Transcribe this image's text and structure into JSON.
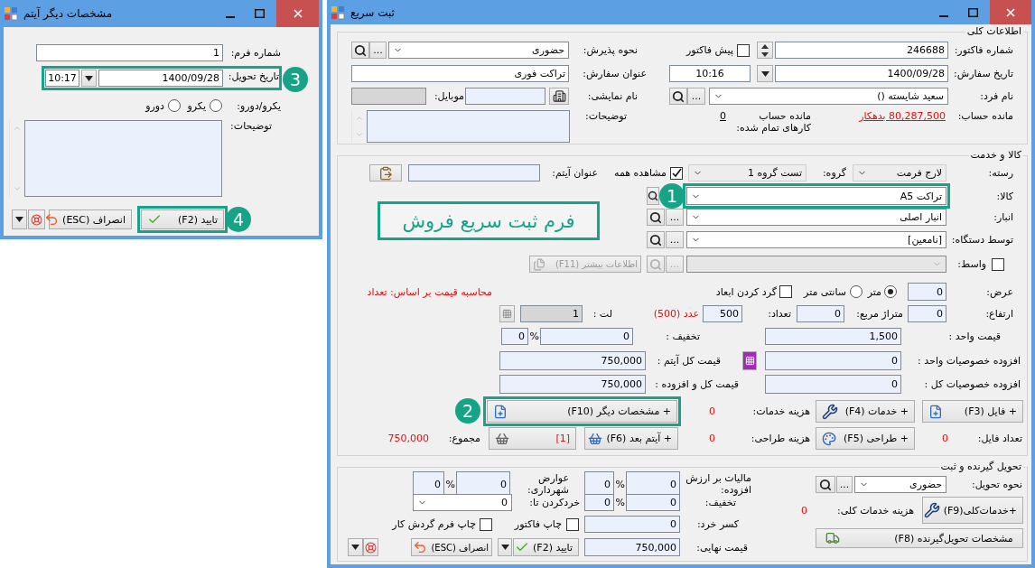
{
  "dialog": {
    "title": "مشخصات دیگر آیتم",
    "form_number": {
      "label": "شماره فرم:",
      "value": "1"
    },
    "delivery_date": {
      "label": "تاریخ تحویل:",
      "date": "1400/09/28",
      "time": "10:17",
      "callout": "3"
    },
    "sides": {
      "label": "یکرو/دورو:",
      "options": [
        {
          "label": "یکرو",
          "selected": false
        },
        {
          "label": "دورو",
          "selected": false
        }
      ]
    },
    "notes": {
      "label": "توضیحات:"
    },
    "ok_button": {
      "label": "تایید (F2)",
      "callout": "4"
    },
    "cancel_button": {
      "label": "انصراف (ESC)"
    }
  },
  "window": {
    "title": "ثبت سریع",
    "general": {
      "legend": "اطلاعات کلی",
      "invoice_number": {
        "label": "شماره فاکتور:",
        "value": "246688"
      },
      "pre_invoice": {
        "label": "پیش فاکتور",
        "checked": false
      },
      "reception": {
        "label": "نحوه پذیرش:",
        "value": "حضوری",
        "browse": "..."
      },
      "order_date": {
        "label": "تاریخ سفارش:",
        "date": "1400/09/28",
        "time": "10:16"
      },
      "order_title": {
        "label": "عنوان سفارش:",
        "value": "تراکت فوری"
      },
      "person": {
        "label": "نام فرد:",
        "value": "سعید شایسته ()",
        "browse": "..."
      },
      "display_name": {
        "label": "نام نمایشی:"
      },
      "mobile": {
        "label": "موبایل:"
      },
      "balance": {
        "label": "مانده حساب:",
        "value": "80,287,500 بدهکار"
      },
      "completed_balance": {
        "label": "مانده حساب کارهای تمام شده:",
        "value": "0"
      },
      "notes": {
        "label": "توضیحات:"
      }
    },
    "goods": {
      "legend": "کالا و خدمت",
      "category": {
        "label": "رسته:",
        "value": "لارج فرمت"
      },
      "group": {
        "label": "گروه:",
        "value": "تست گروه 1"
      },
      "show_all": {
        "label": "مشاهده همه",
        "checked": true
      },
      "item_title": {
        "label": "عنوان آیتم:"
      },
      "selectors": [
        {
          "label": "کالا:",
          "value": "تراکت A5",
          "callout": "1"
        },
        {
          "label": "انبار:",
          "value": "انبار اصلی",
          "browse": "..."
        },
        {
          "label": "توسط دستگاه:",
          "value": "[نامعین]",
          "browse": "..."
        }
      ],
      "intermediary": {
        "label": "واسط:",
        "checked": false,
        "disabled": true,
        "browse": "..."
      },
      "more_info": {
        "label": "اطلاعات بیشتر (F11)",
        "disabled": true
      },
      "banner": "فرم ثبت سریع فروش",
      "width": {
        "label": "عرض:",
        "value": "0"
      },
      "units": [
        {
          "label": "متر",
          "selected": true
        },
        {
          "label": "سانتی متر",
          "selected": false
        }
      ],
      "round_dimensions": {
        "label": "گرد کردن ابعاد",
        "checked": false
      },
      "pricing_basis": "محاسبه قیمت بر اساس: تعداد",
      "height": {
        "label": "ارتفاع:",
        "value": "0"
      },
      "area": {
        "label": "متراژ مربع:",
        "value": "0"
      },
      "quantity": {
        "label": "تعداد:",
        "value": "500",
        "note": "عدد (500)"
      },
      "lot": {
        "label": "لت :",
        "value": "1",
        "disabled": true
      },
      "unit_price": {
        "label": "قیمت واحد :",
        "value": "1,500"
      },
      "discount": {
        "label": "تخفیف :",
        "value": "0",
        "percent_sign": "%",
        "percent": "0"
      },
      "unit_extras": {
        "label": "افزوده خصوصیات واحد :",
        "value": "0"
      },
      "item_total": {
        "label": "قیمت کل آیتم :",
        "value": "750,000"
      },
      "total_extras": {
        "label": "افزوده خصوصیات کل :",
        "value": "0"
      },
      "total_with_extras": {
        "label": "قیمت کل و افزوده :",
        "value": "750,000"
      },
      "file_button": "+ فایل (F3)",
      "services_button": "+ خدمات (F4)",
      "services_cost": {
        "label": "هزینه خدمات:",
        "value": "0"
      },
      "other_specs_button": {
        "label": "+ مشخصات دیگر (F10)",
        "callout": "2"
      },
      "file_count": {
        "label": "تعداد فایل:",
        "value": "0"
      },
      "design_button": "+ طراحی (F5)",
      "design_cost": {
        "label": "هزینه طراحی:",
        "value": "0"
      },
      "next_item_button": "+ آیتم بعد (F6)",
      "cart_button": "[1]",
      "sum": {
        "label": "مجموع:",
        "value": "750,000"
      }
    },
    "delivery": {
      "legend": "تحویل گیرنده و ثبت",
      "method": {
        "label": "نحوه تحویل:",
        "value": "حضوری",
        "browse": "..."
      },
      "general_services_button": "+خدمات‌کلی(F9)",
      "general_services_cost": {
        "label": "هزینه خدمات کلی:",
        "value": "0"
      },
      "receiver_button": "مشخصات تحویل‌گیرنده (F8)",
      "vat": {
        "label": "مالیات بر ارزش افزوده:",
        "value": "0",
        "percent_sign": "%",
        "percent": "0"
      },
      "municipal": {
        "label": "عوارض شهرداری:",
        "value": "0",
        "percent_sign": "%",
        "percent": "0"
      },
      "discount": {
        "label": "تخفیف:",
        "value": "0",
        "percent_sign": "%",
        "percent": "0"
      },
      "round_to": {
        "label": "خردکردن تا:",
        "value": "0"
      },
      "small_change": {
        "label": "کسر خرد:",
        "value": "0"
      },
      "print_invoice": {
        "label": "چاپ فاکتور",
        "checked": false
      },
      "print_workflow": {
        "label": "چاپ فرم گردش کار",
        "checked": false
      },
      "final_price": {
        "label": "قیمت نهایی:",
        "value": "750,000"
      },
      "ok_button": "تایید (F2)",
      "cancel_button": "انصراف (ESC)"
    }
  }
}
